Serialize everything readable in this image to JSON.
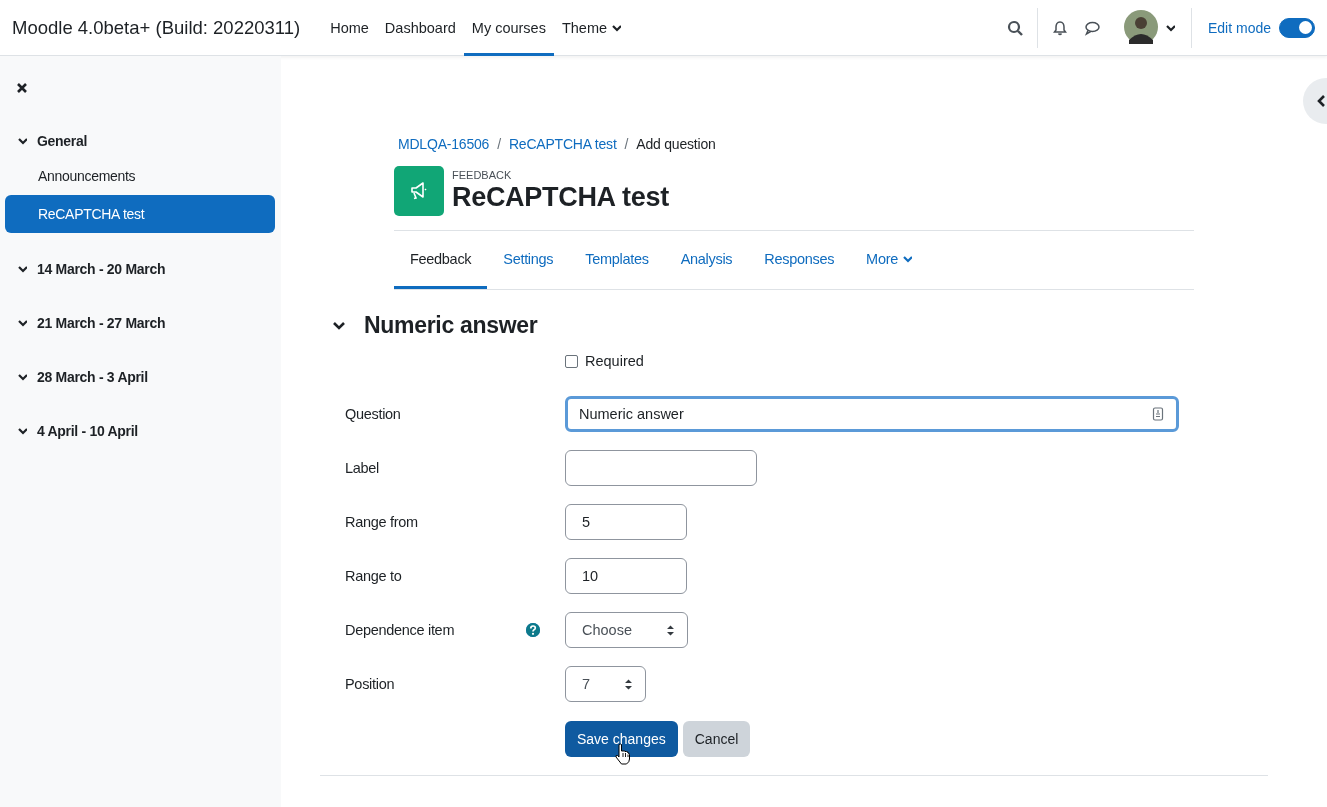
{
  "site_name": "Moodle 4.0beta+ (Build: 20220311)",
  "nav": [
    {
      "label": "Home",
      "selected": false,
      "dropdown": false
    },
    {
      "label": "Dashboard",
      "selected": false,
      "dropdown": false
    },
    {
      "label": "My courses",
      "selected": true,
      "dropdown": false
    },
    {
      "label": "Theme",
      "selected": false,
      "dropdown": true
    }
  ],
  "edit_mode": {
    "label": "Edit mode",
    "on": true
  },
  "drawer": {
    "sections": [
      {
        "title": "General",
        "expanded": true,
        "children": [
          {
            "label": "Announcements",
            "selected": false
          },
          {
            "label": "ReCAPTCHA test",
            "selected": true
          }
        ]
      },
      {
        "title": "14 March - 20 March",
        "expanded": true
      },
      {
        "title": "21 March - 27 March",
        "expanded": true
      },
      {
        "title": "28 March - 3 April",
        "expanded": true
      },
      {
        "title": "4 April - 10 April",
        "expanded": true
      }
    ]
  },
  "breadcrumb": [
    {
      "kind": "link",
      "label": "MDLQA-16506"
    },
    {
      "kind": "separator",
      "label": "/"
    },
    {
      "kind": "link",
      "label": "ReCAPTCHA test"
    },
    {
      "kind": "separator",
      "label": "/"
    },
    {
      "kind": "current",
      "label": "Add question"
    }
  ],
  "activity": {
    "type_label": "FEEDBACK",
    "title": "ReCAPTCHA test"
  },
  "tabs": [
    {
      "label": "Feedback",
      "selected": true,
      "dropdown": false
    },
    {
      "label": "Settings",
      "selected": false,
      "dropdown": false
    },
    {
      "label": "Templates",
      "selected": false,
      "dropdown": false
    },
    {
      "label": "Analysis",
      "selected": false,
      "dropdown": false
    },
    {
      "label": "Responses",
      "selected": false,
      "dropdown": false
    },
    {
      "label": "More",
      "selected": false,
      "dropdown": true
    }
  ],
  "form": {
    "section_title": "Numeric answer",
    "expanded": true,
    "required": {
      "label": "Required",
      "checked": false
    },
    "fields": [
      {
        "kind": "editor",
        "label": "Question",
        "value": "Numeric answer",
        "focused": true,
        "help": false
      },
      {
        "kind": "text",
        "label": "Label",
        "focused": false,
        "help": false
      },
      {
        "kind": "number",
        "label": "Range from",
        "value": "5",
        "focused": false,
        "help": false
      },
      {
        "kind": "number",
        "label": "Range to",
        "value": "10",
        "focused": false,
        "help": false
      },
      {
        "kind": "select",
        "label": "Dependence item",
        "value": "Choose",
        "focused": false,
        "help": true
      },
      {
        "kind": "select",
        "label": "Position",
        "value": "7",
        "focused": false,
        "help": false
      }
    ],
    "buttons": [
      {
        "label": "Save changes",
        "kind": "primary"
      },
      {
        "label": "Cancel",
        "kind": "secondary"
      }
    ]
  }
}
